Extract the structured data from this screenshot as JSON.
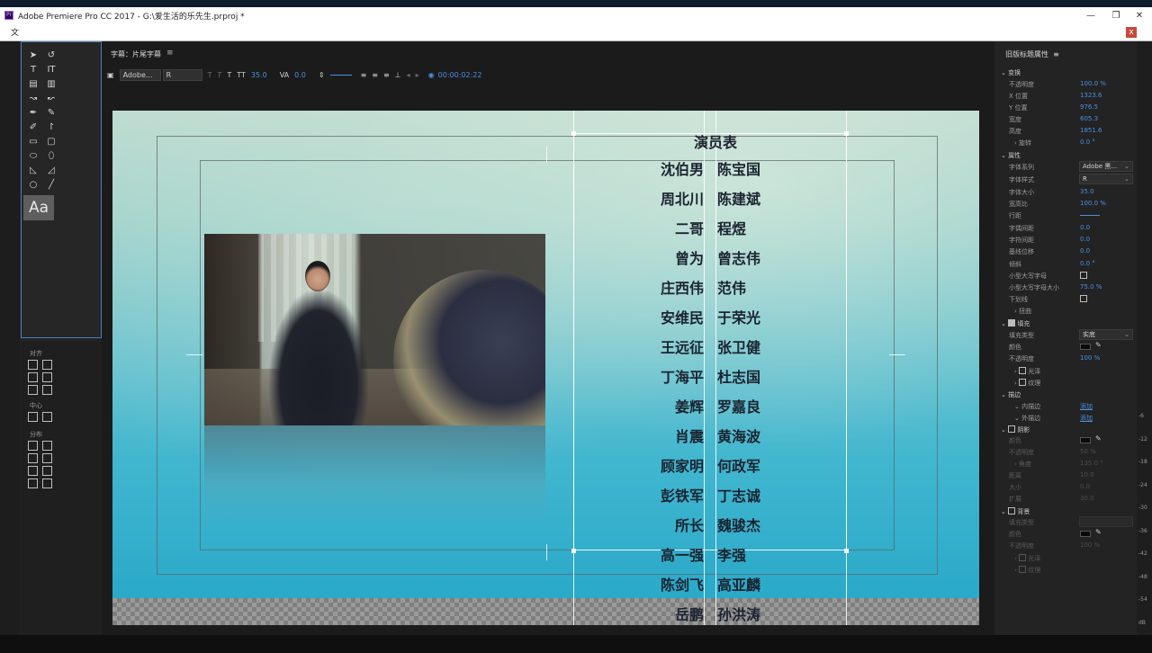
{
  "window": {
    "title": "Adobe Premiere Pro CC 2017 - G:\\爱生活的乐先生.prproj *",
    "app_icon": "Pr",
    "min": "—",
    "max": "❐",
    "close": "✕",
    "menu_first": "文",
    "doc_close": "x"
  },
  "title_panel": {
    "tab": "字幕：片尾字幕",
    "menu_icon": "≡",
    "toolbar": {
      "font_family": "Adobe...",
      "font_style": "R",
      "font_size": "35.0",
      "kerning": "0.0",
      "timecode": "00:00:02:22"
    }
  },
  "credits": {
    "title": "演员表",
    "rows": [
      {
        "role": "沈伯男",
        "name": "陈宝国"
      },
      {
        "role": "周北川",
        "name": "陈建斌"
      },
      {
        "role": "二哥",
        "name": "程煜"
      },
      {
        "role": "曾为",
        "name": "曾志伟"
      },
      {
        "role": "庄西伟",
        "name": "范伟"
      },
      {
        "role": "安维民",
        "name": "于荣光"
      },
      {
        "role": "王远征",
        "name": "张卫健"
      },
      {
        "role": "丁海平",
        "name": "杜志国"
      },
      {
        "role": "姜辉",
        "name": "罗嘉良"
      },
      {
        "role": "肖震",
        "name": "黄海波"
      },
      {
        "role": "顾家明",
        "name": "何政军"
      },
      {
        "role": "彭铁军",
        "name": "丁志诚"
      },
      {
        "role": "所长",
        "name": "魏骏杰"
      },
      {
        "role": "高一强",
        "name": "李强"
      },
      {
        "role": "陈剑飞",
        "name": "高亚麟"
      },
      {
        "role": "岳鹏",
        "name": "孙洪涛"
      }
    ]
  },
  "tools": {
    "aa_label": "Aa",
    "align_label": "对齐",
    "center_label": "中心",
    "distribute_label": "分布"
  },
  "properties": {
    "header": "旧版标题属性",
    "transform": {
      "label": "变换",
      "opacity_label": "不透明度",
      "opacity": "100.0 %",
      "x_label": "X 位置",
      "x": "1323.6",
      "y_label": "Y 位置",
      "y": "976.5",
      "width_label": "宽度",
      "width": "605.3",
      "height_label": "高度",
      "height": "1851.6",
      "rotation_label": "旋转",
      "rotation": "0.0 °"
    },
    "props": {
      "label": "属性",
      "font_family_label": "字体系列",
      "font_family": "Adobe 黑...",
      "font_style_label": "字体样式",
      "font_style": "R",
      "font_size_label": "字体大小",
      "font_size": "35.0",
      "aspect_label": "宽高比",
      "aspect": "100.0 %",
      "leading_label": "行距",
      "kerning_label": "字偶间距",
      "kerning": "0.0",
      "tracking_label": "字符间距",
      "tracking": "0.0",
      "baseline_label": "基线位移",
      "baseline": "0.0",
      "slant_label": "倾斜",
      "slant": "0.0 °",
      "caps_label": "小型大写字母",
      "caps_size_label": "小型大写字母大小",
      "caps_size": "75.0 %",
      "underline_label": "下划线",
      "distort_label": "扭曲"
    },
    "fill": {
      "label": "填充",
      "type_label": "填充类型",
      "type": "实底",
      "color_label": "颜色",
      "opacity_label": "不透明度",
      "opacity": "100 %",
      "sheen_label": "光泽",
      "texture_label": "纹理"
    },
    "stroke": {
      "label": "描边",
      "inner_label": "内描边",
      "inner_add": "添加",
      "outer_label": "外描边",
      "outer_add": "添加"
    },
    "shadow": {
      "label": "阴影",
      "color_label": "颜色",
      "opacity_label": "不透明度",
      "opacity": "50 %",
      "angle_label": "角度",
      "angle": "135.0 °",
      "distance_label": "距离",
      "distance": "10.0",
      "size_label": "大小",
      "size": "0.0",
      "spread_label": "扩展",
      "spread": "30.0"
    },
    "background": {
      "label": "背景",
      "type_label": "填充类型",
      "color_label": "颜色",
      "opacity_label": "不透明度",
      "opacity": "100 %",
      "sheen_label": "光泽",
      "texture_label": "纹理"
    }
  },
  "ruler_marks": [
    "-6",
    "-12",
    "-18",
    "-24",
    "-30",
    "-36",
    "-42",
    "-48",
    "-54",
    "dB"
  ],
  "colors": {
    "accent_blue": "#4a8fe0",
    "panel_bg": "#232323",
    "canvas_teal": "#41b6cf",
    "credit_text": "#1b2330"
  }
}
